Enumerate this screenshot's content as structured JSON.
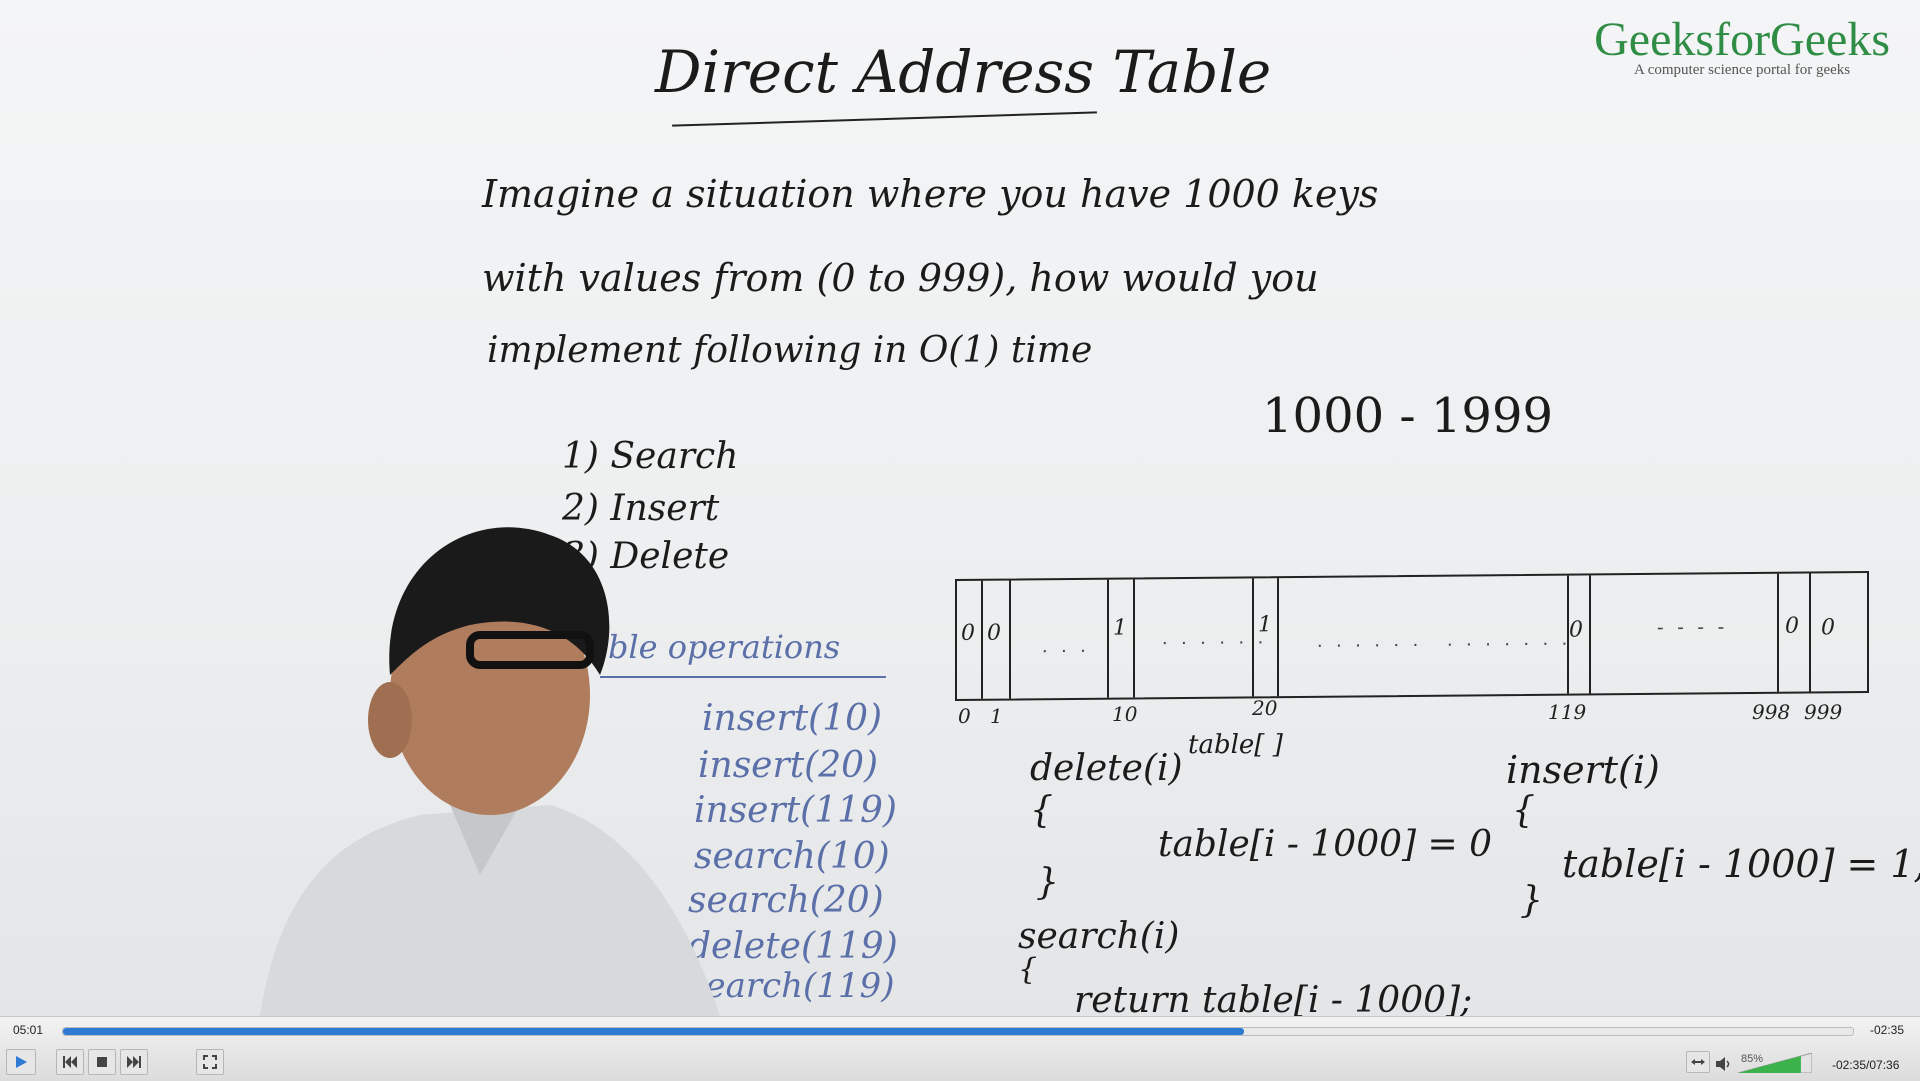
{
  "board": {
    "title": "Direct Address Table",
    "problem_line1": "Imagine a situation where you have 1000 keys",
    "problem_line2": "with values from (0 to 999), how would you",
    "problem_line3": "implement following in O(1) time",
    "range": "1000 - 1999",
    "ops": [
      "1) Search",
      "2) Insert",
      "3) Delete"
    ],
    "ops_heading": "Table operations",
    "op_list": [
      "insert(10)",
      "insert(20)",
      "insert(119)",
      "search(10)",
      "search(20)",
      "delete(119)",
      "search(119)"
    ],
    "table_label": "table[ ]",
    "cells": [
      "0",
      "0",
      "1",
      "1",
      "0",
      "0",
      "0"
    ],
    "indices": [
      "0",
      "1",
      "10",
      "20",
      "119",
      "998",
      "999"
    ],
    "delete_fn": "delete(i)",
    "delete_body": "table[i - 1000] = 0",
    "insert_fn": "insert(i)",
    "insert_body": "table[i - 1000] = 1;",
    "search_fn": "search(i)",
    "search_body": "return table[i - 1000];"
  },
  "logo": {
    "title": "GeeksforGeeks",
    "subtitle": "A computer science portal for geeks",
    "color": "#2f8d46"
  },
  "player": {
    "elapsed": "05:01",
    "remaining": "-02:35",
    "time_display": "-02:35/07:36",
    "volume_label": "85%",
    "progress": 0.66,
    "volume": 0.85,
    "accent": "#2f7ad2",
    "icons": {
      "play": "play-icon",
      "prev": "previous-icon",
      "stop": "stop-icon",
      "next": "next-icon",
      "fullscreen": "fullscreen-icon",
      "aspect": "aspect-ratio-icon",
      "speaker": "speaker-icon"
    }
  }
}
